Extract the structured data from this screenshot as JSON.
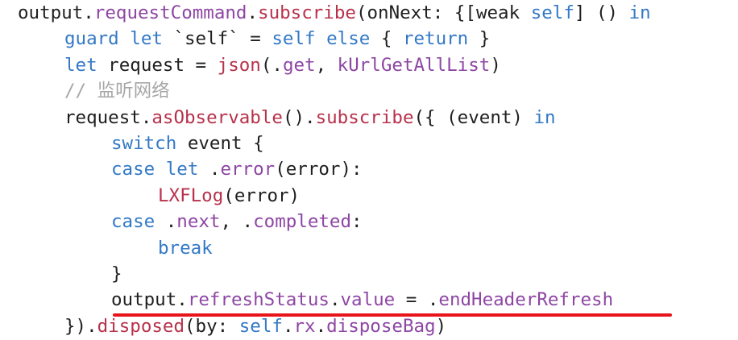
{
  "colors": {
    "plain": "#1f1f1f",
    "keyword": "#3379c6",
    "method": "#b8314b",
    "property": "#8e46a4",
    "comment": "#a7a7a7",
    "annotation_underline": "#e8141c"
  },
  "code_lines": [
    {
      "indent": 0,
      "tokens": [
        {
          "t": "output.",
          "c": "plain"
        },
        {
          "t": "requestCommand",
          "c": "property"
        },
        {
          "t": ".",
          "c": "plain"
        },
        {
          "t": "subscribe",
          "c": "method"
        },
        {
          "t": "(onNext: {[weak ",
          "c": "plain"
        },
        {
          "t": "self",
          "c": "keyword"
        },
        {
          "t": "] () ",
          "c": "plain"
        },
        {
          "t": "in",
          "c": "keyword"
        }
      ]
    },
    {
      "indent": 1,
      "tokens": [
        {
          "t": "guard",
          "c": "keyword"
        },
        {
          "t": " ",
          "c": "plain"
        },
        {
          "t": "let",
          "c": "keyword"
        },
        {
          "t": " `self` = ",
          "c": "plain"
        },
        {
          "t": "self",
          "c": "keyword"
        },
        {
          "t": " ",
          "c": "plain"
        },
        {
          "t": "else",
          "c": "keyword"
        },
        {
          "t": " { ",
          "c": "plain"
        },
        {
          "t": "return",
          "c": "keyword"
        },
        {
          "t": " }",
          "c": "plain"
        }
      ]
    },
    {
      "indent": 1,
      "tokens": [
        {
          "t": "let",
          "c": "keyword"
        },
        {
          "t": " request = ",
          "c": "plain"
        },
        {
          "t": "json",
          "c": "method"
        },
        {
          "t": "(.",
          "c": "plain"
        },
        {
          "t": "get",
          "c": "property"
        },
        {
          "t": ", ",
          "c": "plain"
        },
        {
          "t": "kUrlGetAllList",
          "c": "property"
        },
        {
          "t": ")",
          "c": "plain"
        }
      ]
    },
    {
      "indent": 1,
      "tokens": [
        {
          "t": "// 监听网络",
          "c": "comment"
        }
      ]
    },
    {
      "indent": 1,
      "tokens": [
        {
          "t": "request.",
          "c": "plain"
        },
        {
          "t": "asObservable",
          "c": "method"
        },
        {
          "t": "().",
          "c": "plain"
        },
        {
          "t": "subscribe",
          "c": "method"
        },
        {
          "t": "({ (event) ",
          "c": "plain"
        },
        {
          "t": "in",
          "c": "keyword"
        }
      ]
    },
    {
      "indent": 2,
      "tokens": [
        {
          "t": "switch",
          "c": "keyword"
        },
        {
          "t": " event {",
          "c": "plain"
        }
      ]
    },
    {
      "indent": 2,
      "tokens": [
        {
          "t": "case",
          "c": "keyword"
        },
        {
          "t": " ",
          "c": "plain"
        },
        {
          "t": "let",
          "c": "keyword"
        },
        {
          "t": " .",
          "c": "plain"
        },
        {
          "t": "error",
          "c": "property"
        },
        {
          "t": "(error):",
          "c": "plain"
        }
      ]
    },
    {
      "indent": 3,
      "tokens": [
        {
          "t": "LXFLog",
          "c": "method"
        },
        {
          "t": "(error)",
          "c": "plain"
        }
      ]
    },
    {
      "indent": 2,
      "tokens": [
        {
          "t": "case",
          "c": "keyword"
        },
        {
          "t": " .",
          "c": "plain"
        },
        {
          "t": "next",
          "c": "property"
        },
        {
          "t": ", .",
          "c": "plain"
        },
        {
          "t": "completed",
          "c": "property"
        },
        {
          "t": ":",
          "c": "plain"
        }
      ]
    },
    {
      "indent": 3,
      "tokens": [
        {
          "t": "break",
          "c": "keyword"
        }
      ]
    },
    {
      "indent": 2,
      "tokens": [
        {
          "t": "}",
          "c": "plain"
        }
      ]
    },
    {
      "indent": 2,
      "tokens": [
        {
          "t": "output.",
          "c": "plain"
        },
        {
          "t": "refreshStatus",
          "c": "property"
        },
        {
          "t": ".",
          "c": "plain"
        },
        {
          "t": "value",
          "c": "property"
        },
        {
          "t": " = .",
          "c": "plain"
        },
        {
          "t": "endHeaderRefresh",
          "c": "property"
        }
      ]
    },
    {
      "indent": 1,
      "tokens": [
        {
          "t": "}).",
          "c": "plain"
        },
        {
          "t": "disposed",
          "c": "method"
        },
        {
          "t": "(by: ",
          "c": "plain"
        },
        {
          "t": "self",
          "c": "keyword"
        },
        {
          "t": ".",
          "c": "plain"
        },
        {
          "t": "rx",
          "c": "property"
        },
        {
          "t": ".",
          "c": "plain"
        },
        {
          "t": "disposeBag",
          "c": "property"
        },
        {
          "t": ")",
          "c": "plain"
        }
      ]
    }
  ]
}
